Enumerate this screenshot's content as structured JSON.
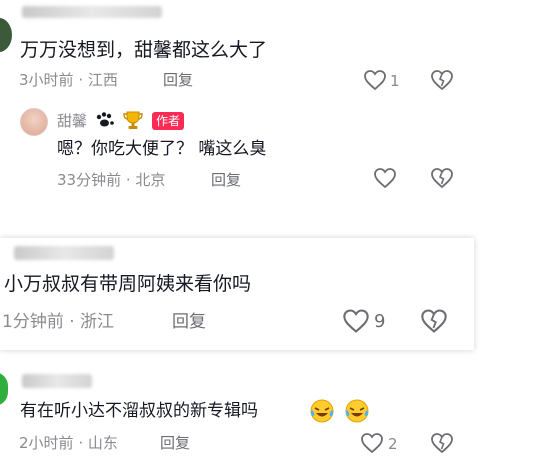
{
  "comment1": {
    "text": "万万没想到，甜馨都这么大了",
    "time": "3小时前",
    "location": "江西",
    "reply_label": "回复",
    "like_count": "1",
    "reply": {
      "nickname": "甜馨",
      "badges": [
        "paw-icon",
        "trophy-icon"
      ],
      "author_tag": "作者",
      "text": "嗯？你吃大便了？ 嘴这么臭",
      "time": "33分钟前",
      "location": "北京",
      "reply_label": "回复"
    }
  },
  "comment2": {
    "text": "小万叔叔有带周阿姨来看你吗",
    "time": "1分钟前",
    "location": "浙江",
    "reply_label": "回复",
    "like_count": "9"
  },
  "comment3": {
    "text": "有在听小达不溜叔叔的新专辑吗",
    "emoji": [
      "laughing-tears-emoji",
      "laughing-tears-emoji"
    ],
    "time": "2小时前",
    "location": "山东",
    "reply_label": "回复",
    "like_count": "2"
  },
  "colors": {
    "author_tag": "#fe2c55",
    "meta_text": "#8a8b91",
    "body_text": "#161823"
  }
}
